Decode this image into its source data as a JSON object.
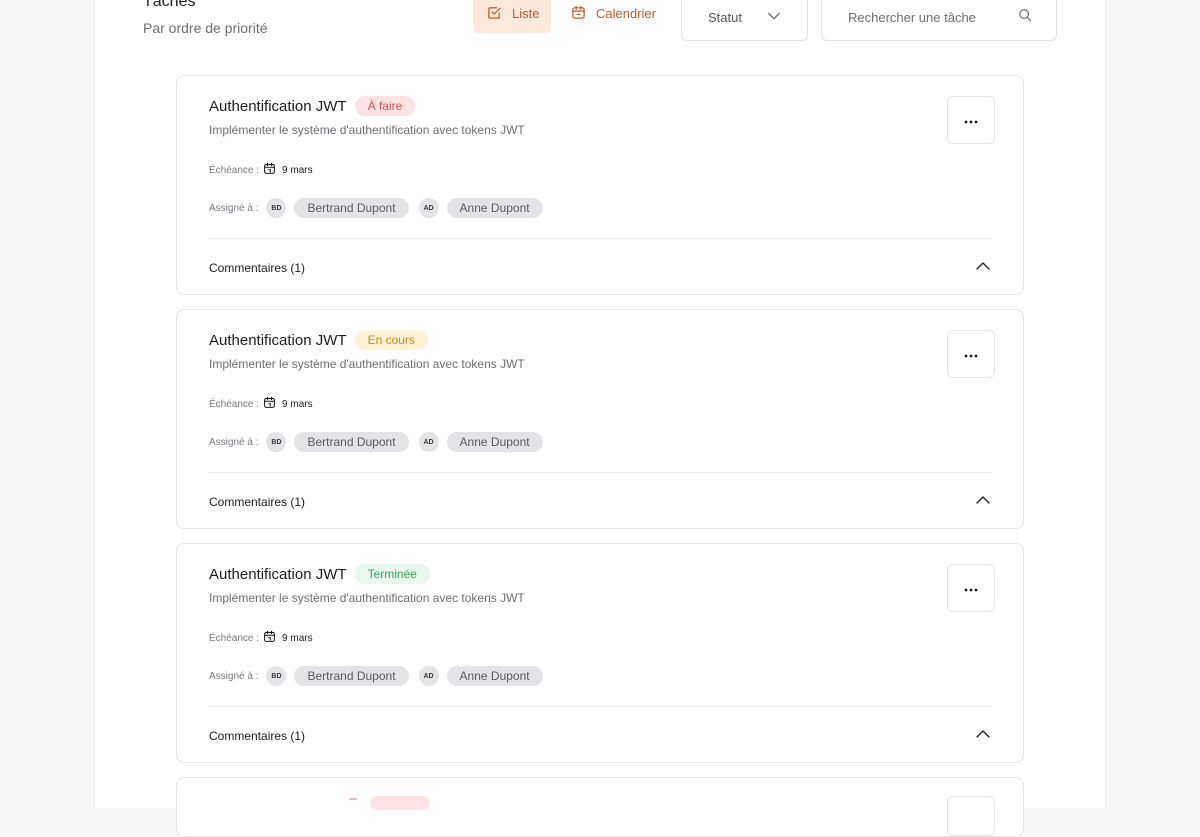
{
  "header": {
    "title": "Tâches",
    "subtitle": "Par ordre de priorité"
  },
  "toolbar": {
    "list_label": "Liste",
    "calendar_label": "Calendrier",
    "status_label": "Statut",
    "search_placeholder": "Rechercher une tâche",
    "accent_color": "#c05a2b"
  },
  "labels": {
    "due": "Échéance :",
    "assigned": "Assigné à :"
  },
  "tasks": [
    {
      "title": "Authentification JWT",
      "status": "À faire",
      "status_color": "#d9534f",
      "description": "Implémenter le système d'authentification avec tokens JWT",
      "due": "9 mars",
      "assignees": [
        {
          "initials": "BD",
          "name": "Bertrand Dupont"
        },
        {
          "initials": "AD",
          "name": "Anne Dupont"
        }
      ],
      "comments": "Commentaires (1)"
    },
    {
      "title": "Authentification JWT",
      "status": "En cours",
      "status_color": "#d08a14",
      "description": "Implémenter le système d'authentification avec tokens JWT",
      "due": "9 mars",
      "assignees": [
        {
          "initials": "BD",
          "name": "Bertrand Dupont"
        },
        {
          "initials": "AD",
          "name": "Anne Dupont"
        }
      ],
      "comments": "Commentaires (1)"
    },
    {
      "title": "Authentification JWT",
      "status": "Terminée",
      "status_color": "#3aa45d",
      "description": "Implémenter le système d'authentification avec tokens JWT",
      "due": "9 mars",
      "assignees": [
        {
          "initials": "BD",
          "name": "Bertrand Dupont"
        },
        {
          "initials": "AD",
          "name": "Anne Dupont"
        }
      ],
      "comments": "Commentaires (1)"
    }
  ]
}
